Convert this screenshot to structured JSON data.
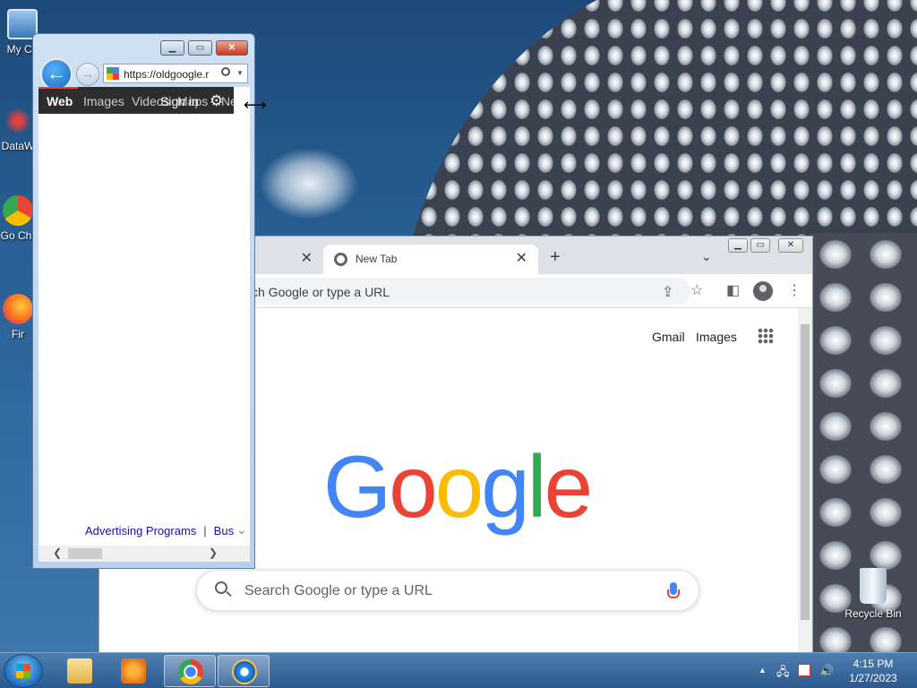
{
  "desktop": {
    "icons": [
      {
        "label": "My Co",
        "icon": "computer-icon"
      },
      {
        "label": "DataW",
        "icon": "datawarehouse-icon"
      },
      {
        "label": "Go Chr",
        "icon": "google-chrome-icon"
      },
      {
        "label": "Fir",
        "icon": "firefox-icon"
      },
      {
        "label": "Recycle Bin",
        "icon": "recycle-bin-icon"
      }
    ]
  },
  "chrome": {
    "tabs": [
      {
        "label": "",
        "close": "✕"
      },
      {
        "label": "New Tab",
        "close": "✕"
      }
    ],
    "new_tab": "+",
    "tab_search": "⌄",
    "omnibox_text": "ch Google or type a URL",
    "window_controls": {
      "minimize": "▁",
      "maximize": "▭",
      "close": "✕"
    },
    "top_links": {
      "gmail": "Gmail",
      "images": "Images"
    },
    "logo": [
      "G",
      "o",
      "o",
      "g",
      "l",
      "e"
    ],
    "search_placeholder": "Search Google or type a URL",
    "icons": {
      "share": "⇪",
      "star": "☆",
      "sidepanel": "◧",
      "menu": "⋮"
    }
  },
  "ie": {
    "address": "https://oldgoogle.r",
    "back": "←",
    "forward": "→",
    "window_controls": {
      "minimize": "▁",
      "maximize": "▭",
      "close": "✕"
    },
    "nav": {
      "web": "Web",
      "images": "Images",
      "videos": "Videos",
      "signin": "Sign in",
      "maps": "Maps",
      "news": "Ne"
    },
    "gear": "⚙",
    "footer": {
      "advertising": "Advertising Programs",
      "separator": "|",
      "business": "Bus"
    },
    "scroll": {
      "left": "❮",
      "right": "❯",
      "down": "⌄"
    }
  },
  "taskbar": {
    "apps": [
      {
        "name": "file-explorer",
        "active": false
      },
      {
        "name": "media-player",
        "active": false
      },
      {
        "name": "chrome",
        "active": true
      },
      {
        "name": "internet-explorer",
        "active": true
      }
    ],
    "tray": {
      "show_hidden": "▲",
      "network": "🖧",
      "volume": "🔊"
    },
    "clock": {
      "time": "4:15 PM",
      "date": "1/27/2023"
    }
  },
  "colors": {
    "google_blue": "#4285f4",
    "google_red": "#ea4335",
    "google_yellow": "#fbbc05",
    "google_green": "#34a853"
  }
}
